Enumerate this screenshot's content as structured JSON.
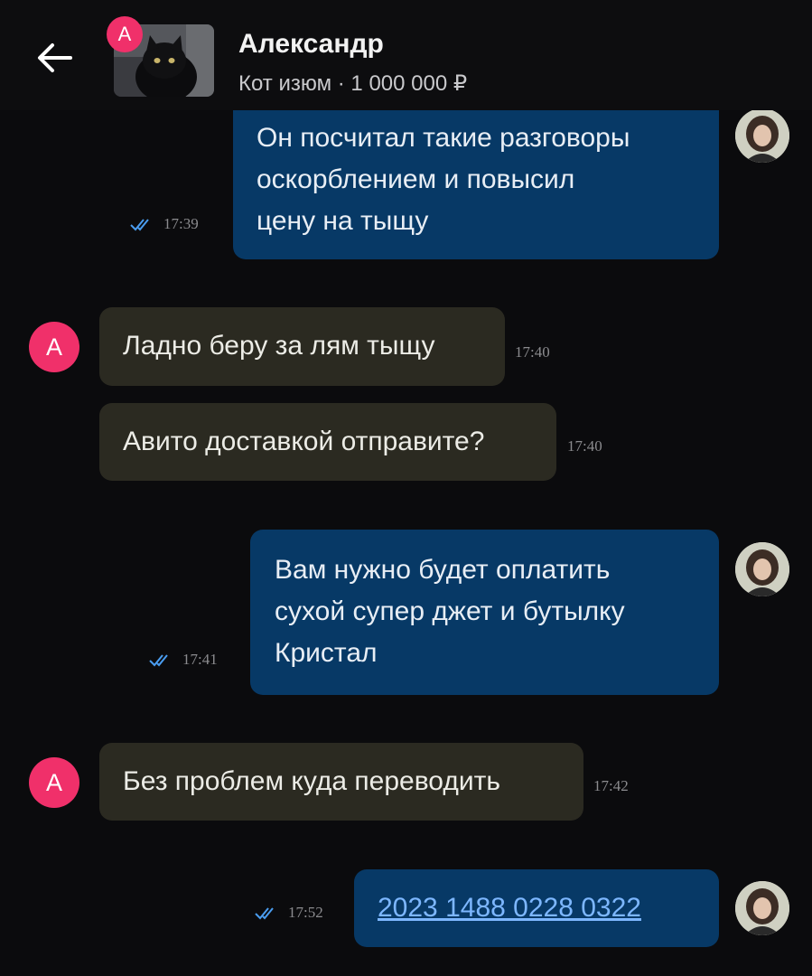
{
  "header": {
    "back_icon": "arrow-left-icon",
    "contact_initial": "А",
    "contact_name": "Александр",
    "listing": "Кот изюм · 1 000 000 ₽"
  },
  "messages": [
    {
      "direction": "out",
      "lines": [
        "Он посчитал такие разговоры",
        "оскорблением и повысил",
        "цену на тыщу"
      ],
      "time": "17:39",
      "status": "read"
    },
    {
      "direction": "in",
      "avatar": "А",
      "text": "Ладно беру за лям тыщу",
      "time": "17:40"
    },
    {
      "direction": "in",
      "text": "Авито доставкой отправите?",
      "time": "17:40"
    },
    {
      "direction": "out",
      "lines": [
        "Вам нужно будет оплатить",
        "сухой супер джет и бутылку",
        "Кристал"
      ],
      "time": "17:41",
      "status": "read"
    },
    {
      "direction": "in",
      "avatar": "А",
      "text": "Без проблем куда переводить",
      "time": "17:42"
    },
    {
      "direction": "out",
      "text": "2023 1488 0228 0322",
      "time": "17:52",
      "status": "read",
      "link": true
    }
  ],
  "colors": {
    "background": "#0b0b0d",
    "outgoing_bubble": "#073966",
    "incoming_bubble": "#2b2a21",
    "avatar_pink": "#f0306a",
    "read_check": "#4a9df0"
  }
}
